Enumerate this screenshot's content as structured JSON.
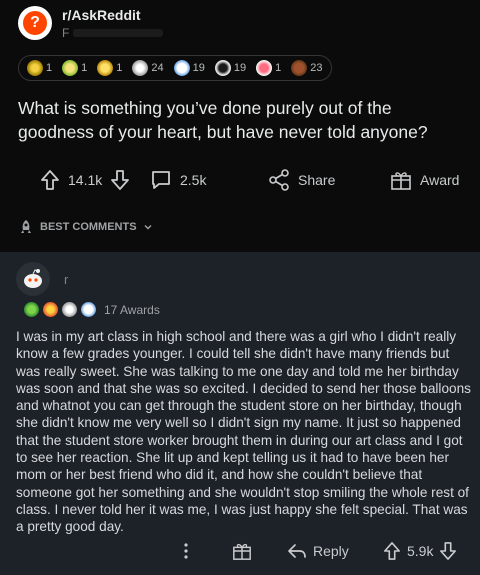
{
  "post": {
    "subreddit": "r/AskReddit",
    "username_initial": "F",
    "awards": [
      {
        "name": "silver-award",
        "count": "1",
        "color": "#c8a000"
      },
      {
        "name": "helpful-award",
        "count": "1",
        "color": "#7fba2f"
      },
      {
        "name": "gold-award",
        "count": "1",
        "color": "#d4a017"
      },
      {
        "name": "salute-award",
        "count": "24",
        "color": "#e5e5e5"
      },
      {
        "name": "laughing-award",
        "count": "19",
        "color": "#f0f0f0"
      },
      {
        "name": "dollar-award",
        "count": "19",
        "color": "#dcdcdc"
      },
      {
        "name": "wholesome-award",
        "count": "1",
        "color": "#ff6b81"
      },
      {
        "name": "poop-award",
        "count": "23",
        "color": "#8b5a2b"
      }
    ],
    "title": "What is something you’ve done purely out of the goodness of your heart, but have never told anyone?",
    "upvotes": "14.1k",
    "comments": "2.5k",
    "share_label": "Share",
    "award_label": "Award"
  },
  "sort": {
    "label": "BEST COMMENTS"
  },
  "comment": {
    "username_initial": "r",
    "awards_label": "17 Awards",
    "body": "I was in my art class in high school and there was a girl who I didn't really know a few grades younger. I could tell she didn't have many friends but was really sweet. She was talking to me one day and told me her birthday was soon and that she was so excited. I decided to send her those balloons and whatnot you can get through the student store on her birthday, though she didn't know me very well so I didn't sign my name. It just so happened that the student store worker brought them in during our art class and I got to see her reaction. She lit up and kept telling us it had to have been her mom or her best friend who did it, and how she couldn't believe that someone got her something and she wouldn't stop smiling the whole rest of class. I never told her it was me, I was just happy she felt special. That was a pretty good day.",
    "reply_label": "Reply",
    "score": "5.9k"
  }
}
